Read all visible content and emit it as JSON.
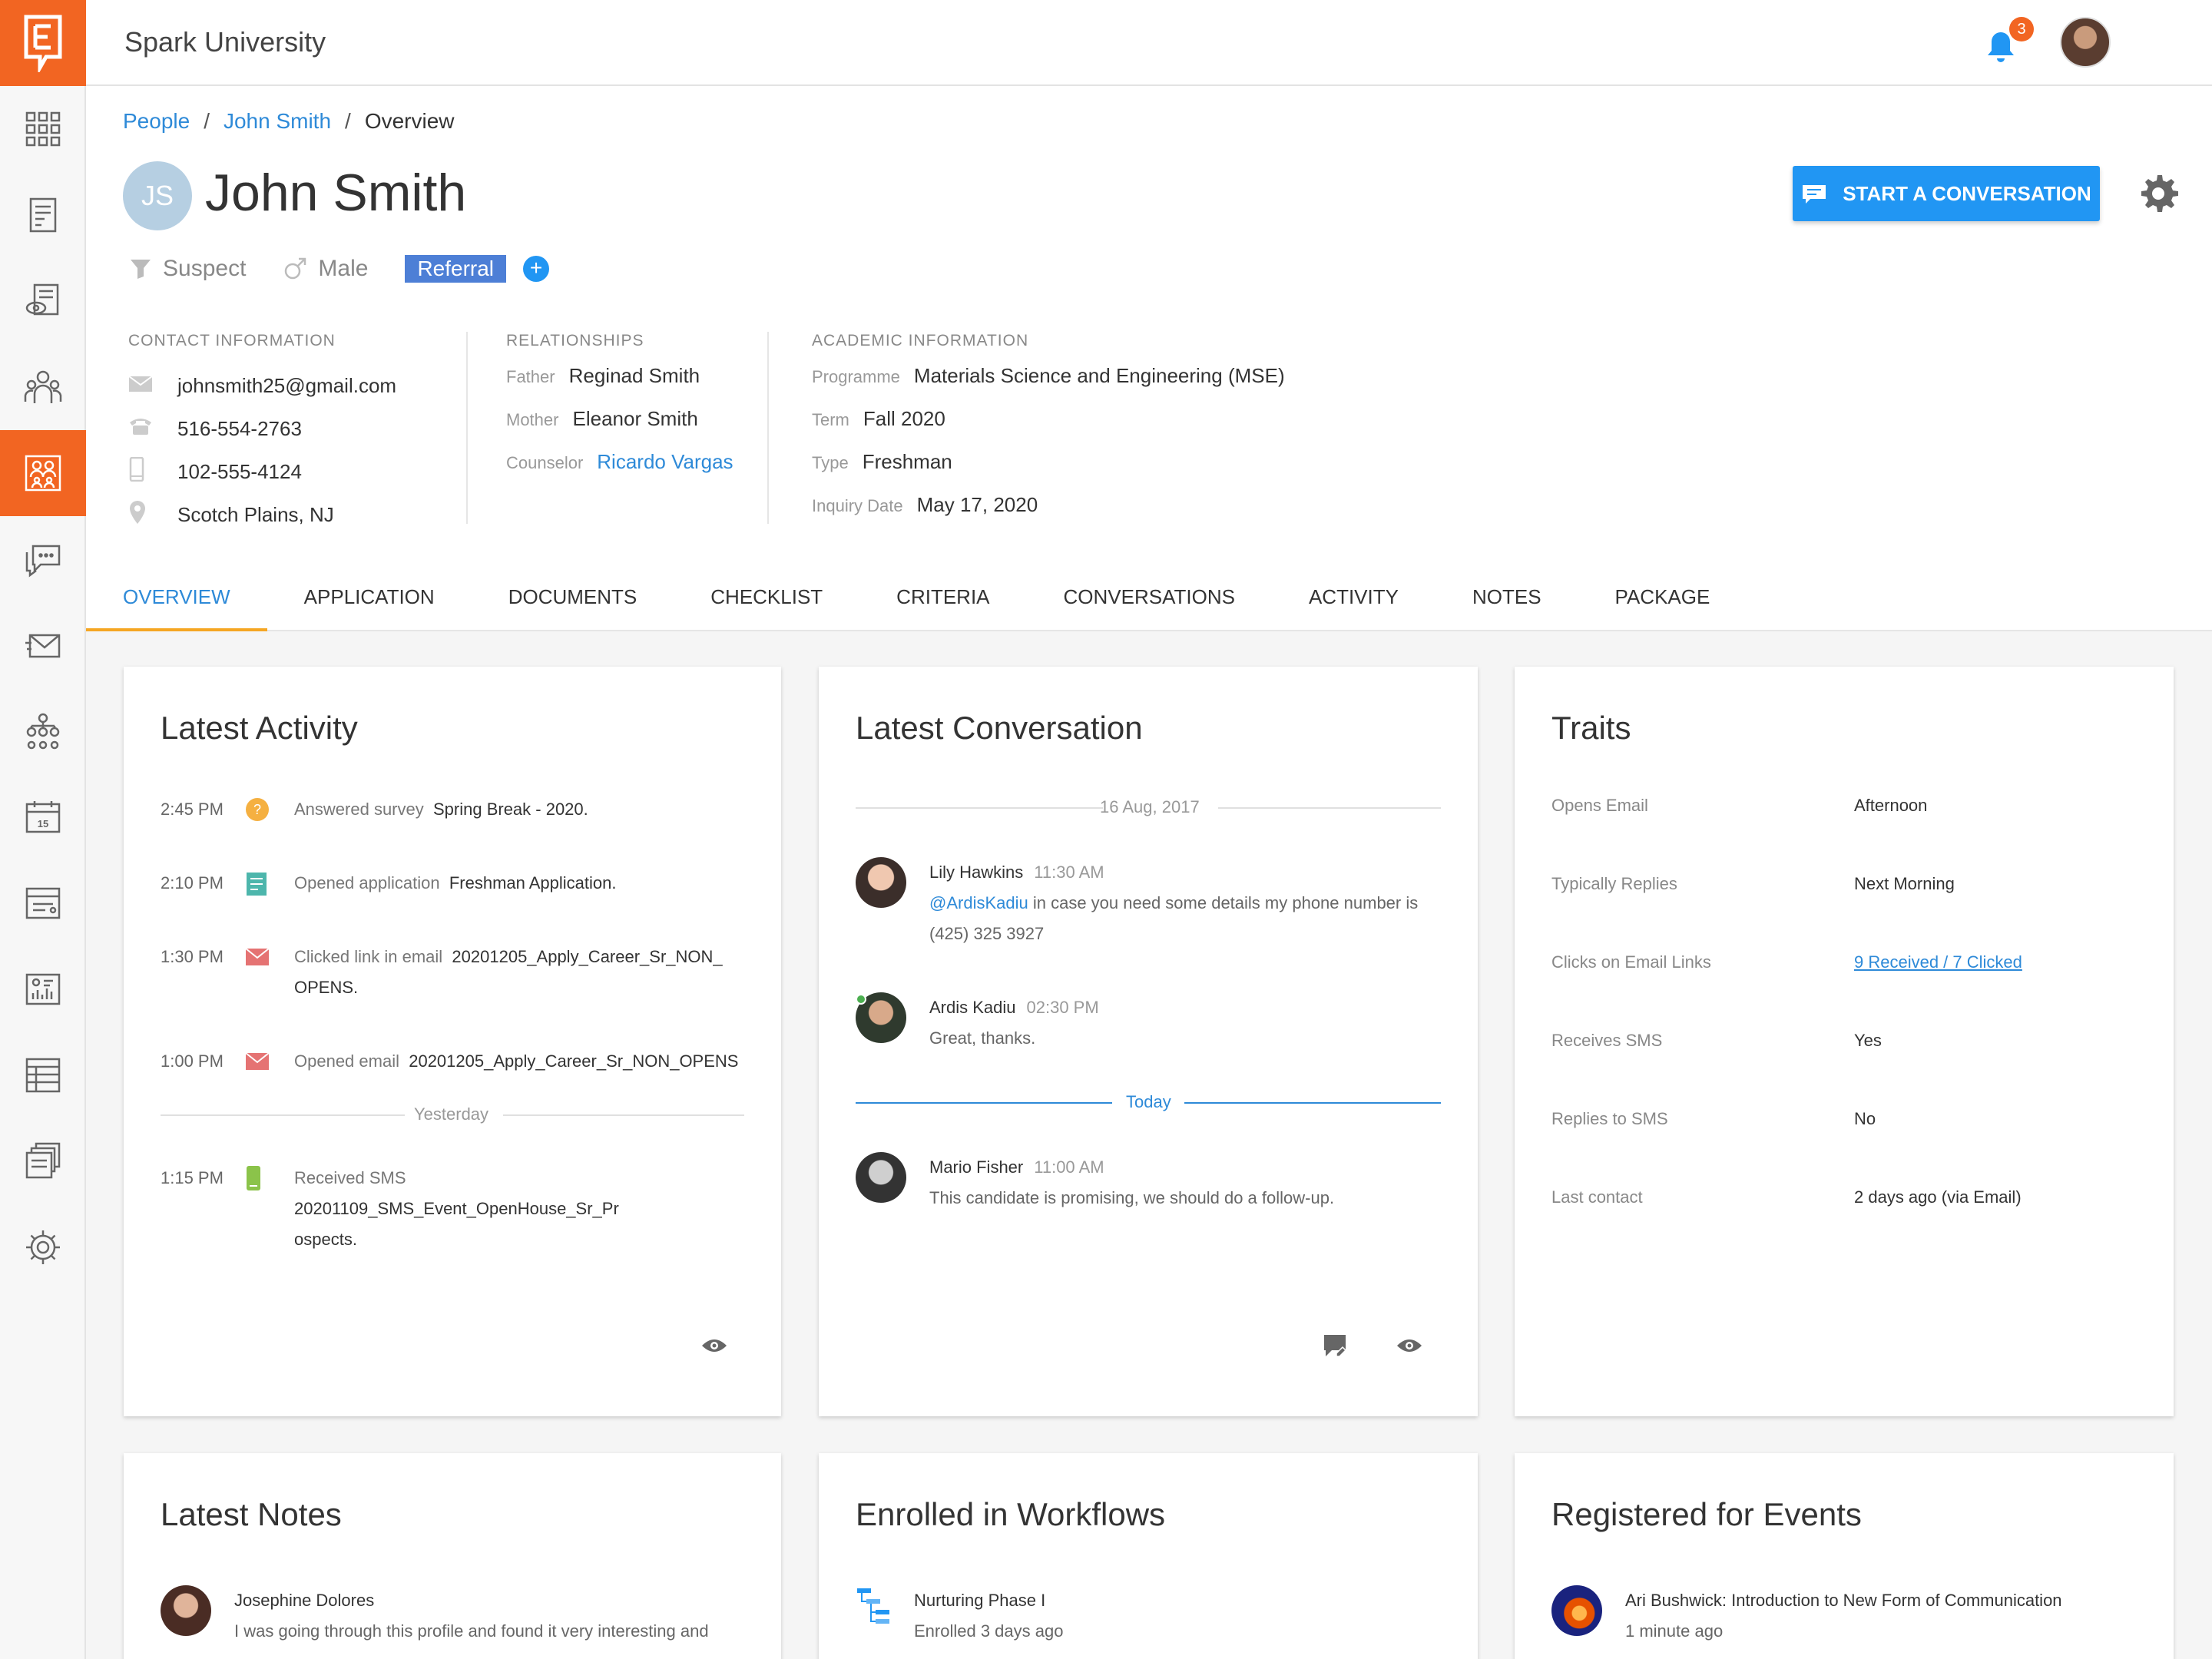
{
  "app": {
    "title": "Spark University",
    "notification_count": "3"
  },
  "sidebar": {
    "items": [
      {
        "icon": "grid-icon"
      },
      {
        "icon": "document-icon"
      },
      {
        "icon": "review-icon"
      },
      {
        "icon": "people-icon"
      },
      {
        "icon": "contacts-icon",
        "active": true
      },
      {
        "icon": "chat-icon"
      },
      {
        "icon": "mail-icon"
      },
      {
        "icon": "workflow-icon"
      },
      {
        "icon": "calendar-icon"
      },
      {
        "icon": "form-icon"
      },
      {
        "icon": "report-icon"
      },
      {
        "icon": "table-icon"
      },
      {
        "icon": "pages-icon"
      },
      {
        "icon": "settings-icon"
      }
    ]
  },
  "breadcrumb": {
    "people": "People",
    "person": "John Smith",
    "current": "Overview",
    "sep": "/"
  },
  "person": {
    "initials": "JS",
    "name": "John Smith",
    "status": "Suspect",
    "gender": "Male",
    "tag": "Referral"
  },
  "actions": {
    "start_conversation": "START A CONVERSATION"
  },
  "contact": {
    "title": "CONTACT INFORMATION",
    "email": "johnsmith25@gmail.com",
    "phone": "516-554-2763",
    "mobile": "102-555-4124",
    "location": "Scotch Plains, NJ"
  },
  "relationships": {
    "title": "RELATIONSHIPS",
    "father_label": "Father",
    "father": "Reginad Smith",
    "mother_label": "Mother",
    "mother": "Eleanor Smith",
    "counselor_label": "Counselor",
    "counselor": "Ricardo Vargas"
  },
  "academic": {
    "title": "ACADEMIC INFORMATION",
    "programme_label": "Programme",
    "programme": "Materials Science and Engineering (MSE)",
    "term_label": "Term",
    "term": "Fall 2020",
    "type_label": "Type",
    "type": "Freshman",
    "inquiry_label": "Inquiry Date",
    "inquiry": "May 17, 2020"
  },
  "tabs": [
    "OVERVIEW",
    "APPLICATION",
    "DOCUMENTS",
    "CHECKLIST",
    "CRITERIA",
    "CONVERSATIONS",
    "ACTIVITY",
    "NOTES",
    "PACKAGE"
  ],
  "latest_activity": {
    "title": "Latest Activity",
    "items": [
      {
        "time": "2:45 PM",
        "action": "Answered survey",
        "target": "Spring Break - 2020."
      },
      {
        "time": "2:10 PM",
        "action": "Opened application",
        "target": "Freshman Application."
      },
      {
        "time": "1:30 PM",
        "action": "Clicked link in email",
        "target": "20201205_Apply_Career_Sr_NON_",
        "target2": "OPENS."
      },
      {
        "time": "1:00 PM",
        "action": "Opened email",
        "target": "20201205_Apply_Career_Sr_NON_OPENS"
      },
      {
        "time": "1:15 PM",
        "action": "Received SMS",
        "target": "20201109_SMS_Event_OpenHouse_Sr_Pr",
        "target2": "ospects."
      }
    ],
    "divider": "Yesterday"
  },
  "latest_conversation": {
    "title": "Latest Conversation",
    "date_divider": "16 Aug, 2017",
    "today_divider": "Today",
    "messages": [
      {
        "name": "Lily Hawkins",
        "time": "11:30 AM",
        "mention": "@ArdisKadiu",
        "text": " in case you need some details my phone number is",
        "text2": "(425) 325 3927"
      },
      {
        "name": "Ardis Kadiu",
        "time": "02:30 PM",
        "text": "Great, thanks."
      },
      {
        "name": "Mario Fisher",
        "time": "11:00 AM",
        "text": "This candidate is promising, we should do a follow-up."
      }
    ]
  },
  "traits": {
    "title": "Traits",
    "items": [
      {
        "label": "Opens Email",
        "value": "Afternoon"
      },
      {
        "label": "Typically Replies",
        "value": "Next Morning"
      },
      {
        "label": "Clicks on Email Links",
        "value": "9 Received / 7 Clicked"
      },
      {
        "label": "Receives SMS",
        "value": "Yes"
      },
      {
        "label": "Replies to SMS",
        "value": "No"
      },
      {
        "label": "Last contact",
        "value": "2 days ago (via Email)"
      }
    ]
  },
  "latest_notes": {
    "title": "Latest Notes",
    "author": "Josephine Dolores",
    "text": "I was going through this profile and found it very interesting and"
  },
  "workflows": {
    "title": "Enrolled in Workflows",
    "name": "Nurturing Phase I",
    "meta": "Enrolled 3 days ago"
  },
  "events": {
    "title": "Registered for Events",
    "name": "Ari Bushwick: Introduction to New Form of Communication",
    "meta": "1 minute ago"
  },
  "colors": {
    "brand": "#f26522",
    "accent": "#2196f3",
    "link": "#2e8ad8",
    "tab_indicator": "#f5a623"
  }
}
